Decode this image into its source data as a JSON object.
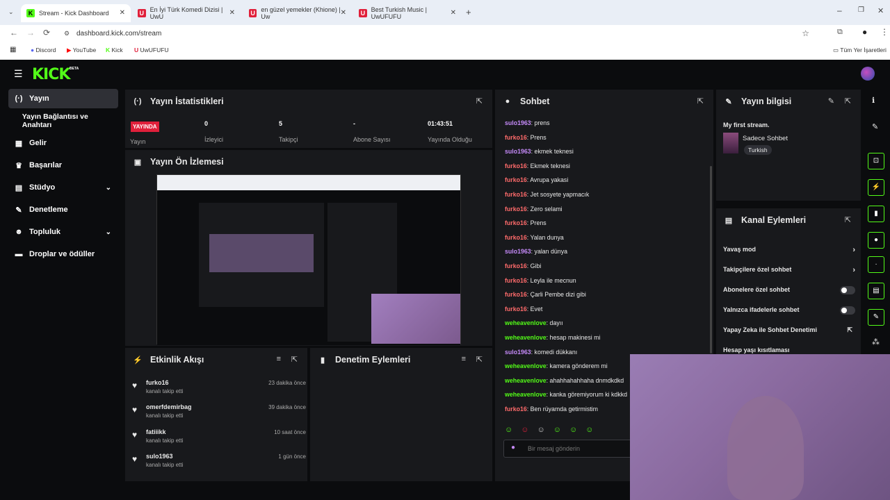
{
  "browser": {
    "tabs": [
      {
        "label": "Stream - Kick Dashboard",
        "fav": "K",
        "color": "#53fc18"
      },
      {
        "label": "En İyi Türk Komedi Dizisi | UwU",
        "fav": "U",
        "color": "#e0203b"
      },
      {
        "label": "en güzel yemekler (Khione) | Uw",
        "fav": "U",
        "color": "#e0203b"
      },
      {
        "label": "Best Turkish Music | UwUFUFU",
        "fav": "U",
        "color": "#e0203b"
      }
    ],
    "url": "dashboard.kick.com/stream",
    "bookmarks": [
      "Discord",
      "YouTube",
      "Kick",
      "UwUFUFU"
    ],
    "all_bookmarks": "Tüm Yer İşaretleri"
  },
  "logo": "KICK",
  "logo_badge": "BETA",
  "sidebar": [
    {
      "label": "Yayın",
      "icon": "broadcast-icon"
    },
    {
      "label": "Yayın Bağlantısı ve Anahtarı",
      "icon": ""
    },
    {
      "label": "Gelir",
      "icon": "revenue-icon"
    },
    {
      "label": "Başarılar",
      "icon": "trophy-icon"
    },
    {
      "label": "Stüdyo",
      "icon": "studio-icon",
      "chevron": true
    },
    {
      "label": "Denetleme",
      "icon": "wrench-icon"
    },
    {
      "label": "Topluluk",
      "icon": "community-icon",
      "chevron": true
    },
    {
      "label": "Droplar ve ödüller",
      "icon": "drops-icon"
    }
  ],
  "stats": {
    "title": "Yayın İstatistikleri",
    "live_badge": "YAYINDA",
    "items": [
      {
        "label": "Yayın",
        "value": ""
      },
      {
        "label": "İzleyici",
        "value": "0"
      },
      {
        "label": "Takipçi",
        "value": "5"
      },
      {
        "label": "Abone Sayısı",
        "value": "-"
      },
      {
        "label": "Yayında Olduğu",
        "value": "01:43:51"
      }
    ]
  },
  "preview": {
    "title": "Yayın Ön İzlemesi"
  },
  "activity": {
    "title": "Etkinlik Akışı",
    "events": [
      {
        "user": "furko16",
        "action": "kanalı takip etti",
        "time": "23 dakika önce"
      },
      {
        "user": "omerfdemirbag",
        "action": "kanalı takip etti",
        "time": "39 dakika önce"
      },
      {
        "user": "fatiiikk",
        "action": "kanalı takip etti",
        "time": "10 saat önce"
      },
      {
        "user": "sulo1963",
        "action": "kanalı takip etti",
        "time": "1 gün önce"
      }
    ]
  },
  "moderation": {
    "title": "Denetim Eylemleri"
  },
  "chat": {
    "title": "Sohbet",
    "placeholder": "Bir mesaj gönderin",
    "messages": [
      {
        "user": "sulo1963",
        "text": "prens",
        "color": "#c58af9"
      },
      {
        "user": "furko16",
        "text": "Prens",
        "color": "#ff6b6b"
      },
      {
        "user": "sulo1963",
        "text": "ekmek teknesi",
        "color": "#c58af9"
      },
      {
        "user": "furko16",
        "text": "Ekmek teknesi",
        "color": "#ff6b6b"
      },
      {
        "user": "furko16",
        "text": "Avrupa yakasi",
        "color": "#ff6b6b"
      },
      {
        "user": "furko16",
        "text": "Jet sosyete yapmacık",
        "color": "#ff6b6b"
      },
      {
        "user": "furko16",
        "text": "Zero selami",
        "color": "#ff6b6b"
      },
      {
        "user": "furko16",
        "text": "Prens",
        "color": "#ff6b6b"
      },
      {
        "user": "furko16",
        "text": "Yalan dunya",
        "color": "#ff6b6b"
      },
      {
        "user": "sulo1963",
        "text": "yalan dünya",
        "color": "#c58af9"
      },
      {
        "user": "furko16",
        "text": "Gibi",
        "color": "#ff6b6b"
      },
      {
        "user": "furko16",
        "text": "Leyla ile mecnun",
        "color": "#ff6b6b"
      },
      {
        "user": "furko16",
        "text": "Çarli Pembe dizi gibi",
        "color": "#ff6b6b"
      },
      {
        "user": "furko16",
        "text": "Evet",
        "color": "#ff6b6b"
      },
      {
        "user": "weheavenlove",
        "text": "dayıı",
        "color": "#53fc18"
      },
      {
        "user": "weheavenlove",
        "text": "hesap makinesi mi",
        "color": "#53fc18"
      },
      {
        "user": "sulo1963",
        "text": "komedi dükkanı",
        "color": "#c58af9"
      },
      {
        "user": "weheavenlove",
        "text": "kamera gönderem mi",
        "color": "#53fc18"
      },
      {
        "user": "weheavenlove",
        "text": "ahahhahahhaha dnmdkdkd",
        "color": "#53fc18"
      },
      {
        "user": "weheavenlove",
        "text": "kanka göremiyorum ki kdkkd",
        "color": "#53fc18"
      },
      {
        "user": "furko16",
        "text": "Ben rüyamda getirmistim",
        "color": "#ff6b6b"
      }
    ]
  },
  "info": {
    "title": "Yayın bilgisi",
    "stream_title": "My first stream.",
    "category": "Sadece Sohbet",
    "language": "Turkish"
  },
  "actions": {
    "title": "Kanal Eylemleri",
    "items": [
      {
        "label": "Yavaş mod",
        "control": "chevron"
      },
      {
        "label": "Takipçilere özel sohbet",
        "control": "chevron"
      },
      {
        "label": "Abonelere özel sohbet",
        "control": "toggle"
      },
      {
        "label": "Yalnızca ifadelerle sohbet",
        "control": "toggle"
      },
      {
        "label": "Yapay Zeka ile Sohbet Denetimi",
        "control": "external"
      },
      {
        "label": "Hesap yaşı kısıtlaması",
        "control": "chevron"
      }
    ]
  },
  "colors": {
    "accent": "#53fc18",
    "panel": "#18191c",
    "live": "#e0203b"
  }
}
